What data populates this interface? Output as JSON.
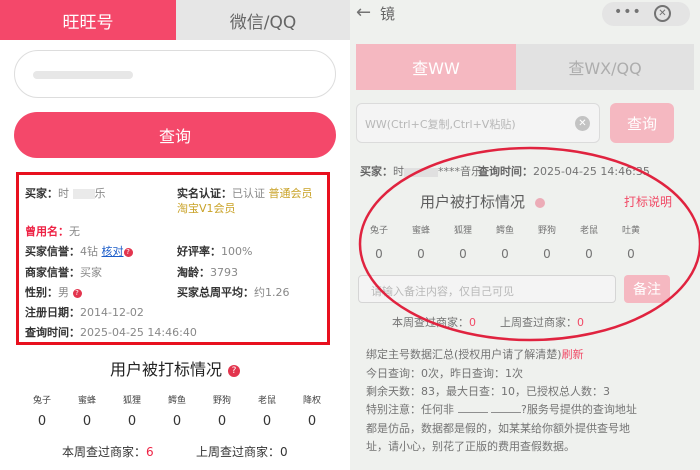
{
  "left": {
    "tabs": [
      {
        "label": "旺旺号"
      },
      {
        "label": "微信/QQ"
      }
    ],
    "query_button": "查询",
    "info": {
      "buyer_label": "买家：",
      "buyer_prefix": "时",
      "buyer_suffix": "乐",
      "realname_label": "实名认证：",
      "realname_value": "已认证",
      "member_badge": "普通会员",
      "taobao_badge": "淘宝V1会员",
      "former_label": "曾用名：",
      "former_value": "无",
      "buyer_credit_label": "买家信誉：",
      "buyer_credit_value": "4钻",
      "verify_link": "核对",
      "good_rate_label": "好评率：",
      "good_rate_value": "100%",
      "seller_credit_label": "商家信誉：",
      "seller_credit_value": "买家",
      "age_label": "淘龄：",
      "age_value": "3793",
      "gender_label": "性别：",
      "gender_value": "男",
      "avg_label": "买家总周平均：",
      "avg_value": "约1.26",
      "reg_label": "注册日期：",
      "reg_value": "2014-12-02",
      "time_label": "查询时间：",
      "time_value": "2025-04-25 14:46:40"
    },
    "marks": {
      "title": "用户被打标情况",
      "categories": [
        "兔子",
        "蜜蜂",
        "狐狸",
        "鳄鱼",
        "野狗",
        "老鼠",
        "降权"
      ],
      "counts": [
        "0",
        "0",
        "0",
        "0",
        "0",
        "0",
        "0"
      ]
    },
    "week": {
      "this_week_label": "本周查过商家：",
      "this_week_value": "6",
      "last_week_label": "上周查过商家：",
      "last_week_value": "0"
    }
  },
  "right": {
    "nav_title": "镜",
    "capsule_dots": "•••",
    "tabs": [
      {
        "label": "查WW"
      },
      {
        "label": "查WX/QQ"
      }
    ],
    "input_placeholder": "WW(Ctrl+C复制,Ctrl+V粘贴)",
    "query_button": "查询",
    "buyer_label": "买家：",
    "buyer_prefix": "时",
    "buyer_suffix": "****音乐",
    "time_label": "查询时间：",
    "time_value": "2025-04-25 14:46:35",
    "marks_title": "用户被打标情况",
    "marks_link": "打标说明",
    "categories": [
      "兔子",
      "蜜蜂",
      "狐狸",
      "鳄鱼",
      "野狗",
      "老鼠",
      "吐黄"
    ],
    "counts": [
      "0",
      "0",
      "0",
      "0",
      "0",
      "0",
      "0"
    ],
    "note_placeholder": "请输入备注内容，仅自己可见",
    "note_button": "备注",
    "this_week_label": "本周查过商家：",
    "this_week_value": "0",
    "last_week_label": "上周查过商家：",
    "last_week_value": "0",
    "summary": {
      "line1a": "绑定主号数据汇总(授权用户请了解清楚)",
      "line1b": "刷新",
      "line2": "今日查询：0次，昨日查询：1次",
      "line3": "剩余天数：83，最大日查：10，已授权总人数：3",
      "line4a": "特别注意：任何非",
      "line4b": "?服务号提供的查询地址",
      "line5": "都是仿品，数据都是假的，如某某给你额外提供查号地",
      "line6": "址，请小心，别花了正版的费用查假数据。"
    }
  }
}
